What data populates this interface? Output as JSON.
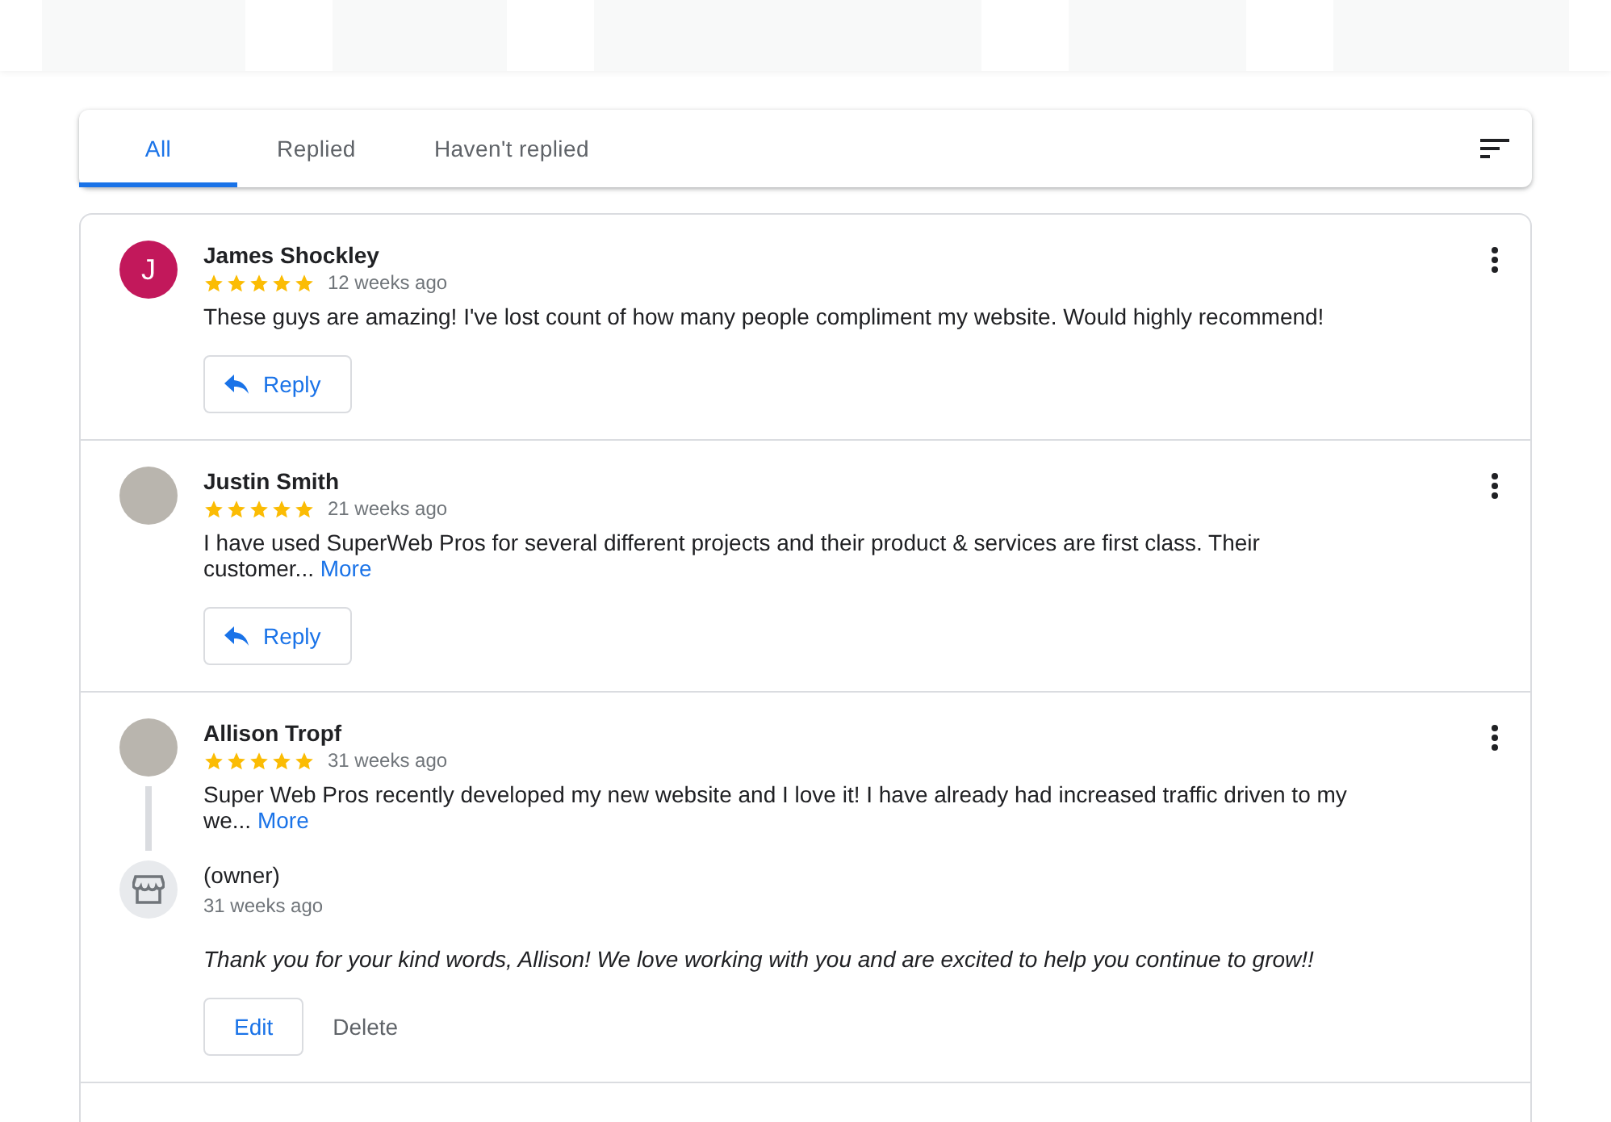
{
  "tabs": [
    {
      "label": "All",
      "selected": true
    },
    {
      "label": "Replied",
      "selected": false
    },
    {
      "label": "Haven't replied",
      "selected": false
    }
  ],
  "reviews": [
    {
      "name": "James Shockley",
      "avatar": {
        "kind": "letter",
        "letter": "J",
        "color": "#c2185b"
      },
      "stars": 5,
      "time": "12 weeks ago",
      "text": "These guys are amazing! I've lost count of how many people compliment my website. Would highly recommend!",
      "button": "Reply"
    },
    {
      "name": "Justin Smith",
      "avatar": {
        "kind": "photo"
      },
      "stars": 5,
      "time": "21 weeks ago",
      "text": "I have used SuperWeb Pros for several different projects and their product & services are first class. Their customer...",
      "more": "More",
      "button": "Reply"
    },
    {
      "name": "Allison Tropf",
      "avatar": {
        "kind": "photo"
      },
      "stars": 5,
      "time": "31 weeks ago",
      "text": "Super Web Pros recently developed my new website and I love it! I have already had increased traffic driven to my we...",
      "more": "More",
      "owner_reply": {
        "name": "(owner)",
        "time": "31 weeks ago",
        "text": "Thank you for your kind words, Allison! We love working with you and are excited to help you continue to grow!!",
        "edit": "Edit",
        "delete": "Delete"
      }
    }
  ]
}
